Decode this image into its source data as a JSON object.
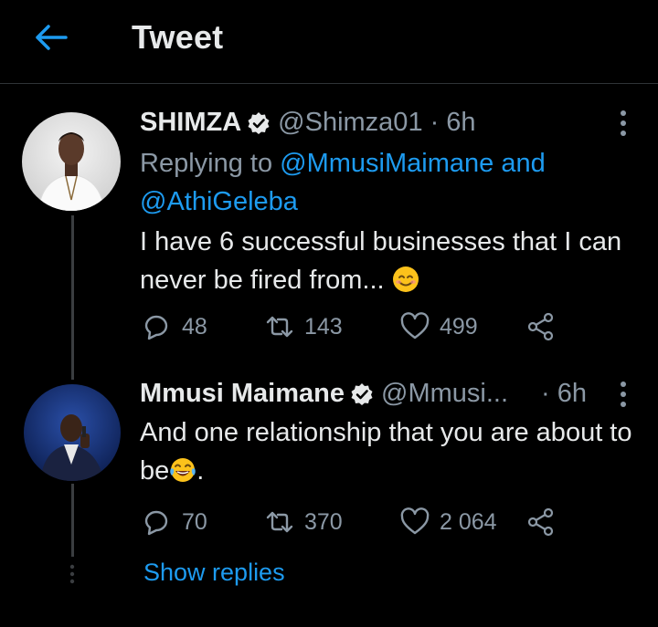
{
  "header": {
    "title": "Tweet",
    "back_icon": "arrow-left-icon"
  },
  "colors": {
    "accent": "#1d9bf0",
    "secondary_text": "#8b98a5",
    "background": "#000000"
  },
  "tweets": [
    {
      "name": "SHIMZA",
      "verified": true,
      "handle": "@Shimza01",
      "time": "· 6h",
      "replying_prefix": "Replying to",
      "replying_first": "@MmusiMaimane",
      "replying_and": "and",
      "replying_second": "@AthiGeleba",
      "text": "I have 6 successful businesses that I can never be fired from...",
      "emoji": "smiling-face-icon",
      "replies": "48",
      "retweets": "143",
      "likes": "499"
    },
    {
      "name": "Mmusi Maimane",
      "verified": true,
      "handle": "@Mmusi...",
      "time": "· 6h",
      "text": "And one relationship that you are about to be",
      "text_end": ".",
      "emoji": "tears-of-joy-icon",
      "replies": "70",
      "retweets": "370",
      "likes": "2 064"
    }
  ],
  "show_replies": "Show replies"
}
